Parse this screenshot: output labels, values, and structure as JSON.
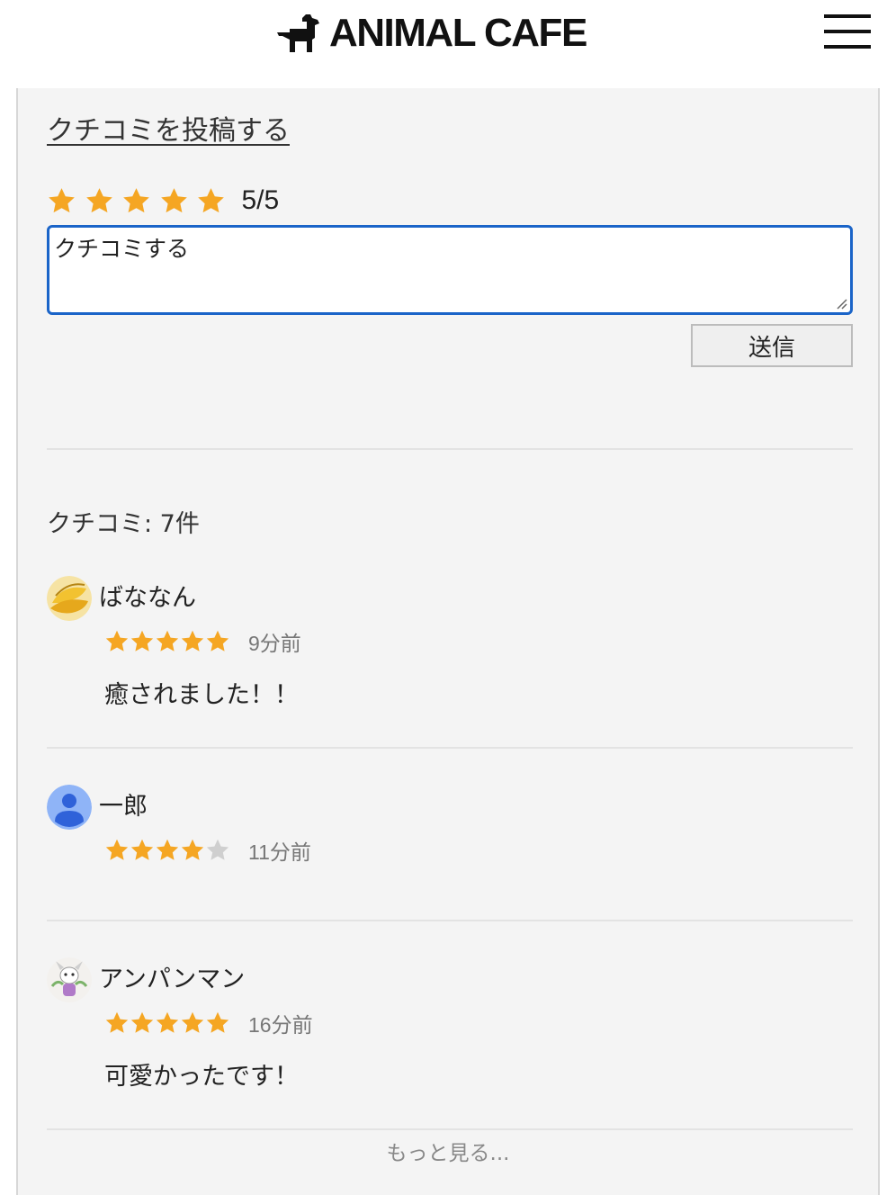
{
  "header": {
    "brand": "ANIMAL CAFE",
    "logo_icon": "dog-icon",
    "menu_icon": "hamburger-menu-icon"
  },
  "post": {
    "title": "クチコミを投稿する",
    "rating_value": "5/5",
    "rating": 5,
    "textarea_value": "クチコミする",
    "submit_label": "送信"
  },
  "reviews": {
    "count_label": "クチコミ: 7件",
    "items": [
      {
        "name": "ばななん",
        "rating": 5,
        "time": "9分前",
        "text": "癒されました！！",
        "avatar": "banana-avatar"
      },
      {
        "name": "一郎",
        "rating": 4,
        "time": "11分前",
        "text": "",
        "avatar": "default-user-avatar"
      },
      {
        "name": "アンパンマン",
        "rating": 5,
        "time": "16分前",
        "text": "可愛かったです！",
        "avatar": "animal-avatar"
      }
    ],
    "more_label": "もっと見る..."
  },
  "colors": {
    "star_filled": "#f5a623",
    "star_empty": "#cfcfcf",
    "textarea_border": "#1a64c8",
    "panel_bg": "#f4f4f4"
  }
}
